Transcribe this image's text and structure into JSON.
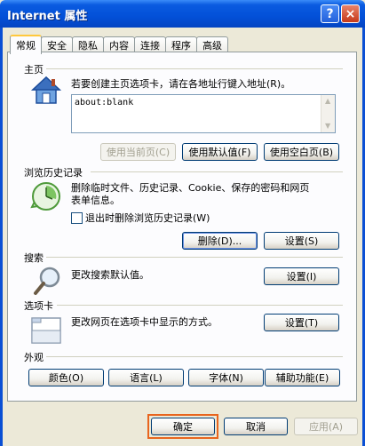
{
  "window": {
    "title": "Internet 属性",
    "help_label": "?",
    "close_label": "×"
  },
  "tabs": [
    {
      "label": "常规",
      "active": true
    },
    {
      "label": "安全",
      "active": false
    },
    {
      "label": "隐私",
      "active": false
    },
    {
      "label": "内容",
      "active": false
    },
    {
      "label": "连接",
      "active": false
    },
    {
      "label": "程序",
      "active": false
    },
    {
      "label": "高级",
      "active": false
    }
  ],
  "homepage": {
    "group_label": "主页",
    "description": "若要创建主页选项卡，请在各地址行键入地址(R)。",
    "url_value": "about:blank",
    "btn_current": "使用当前页(C)",
    "btn_default": "使用默认值(F)",
    "btn_blank": "使用空白页(B)",
    "icon": "house-icon"
  },
  "history": {
    "group_label": "浏览历史记录",
    "description_line1": "删除临时文件、历史记录、Cookie、保存的密码和网页",
    "description_line2": "表单信息。",
    "checkbox_label": "退出时删除浏览历史记录(W)",
    "checkbox_checked": false,
    "btn_delete": "删除(D)...",
    "btn_settings": "设置(S)",
    "icon": "history-clock-icon"
  },
  "search": {
    "group_label": "搜索",
    "description": "更改搜索默认值。",
    "btn_settings": "设置(I)",
    "icon": "magnifier-icon"
  },
  "tabs_group": {
    "group_label": "选项卡",
    "description": "更改网页在选项卡中显示的方式。",
    "btn_settings": "设置(T)",
    "icon": "tabs-window-icon"
  },
  "appearance": {
    "group_label": "外观",
    "btn_colors": "颜色(O)",
    "btn_languages": "语言(L)",
    "btn_fonts": "字体(N)",
    "btn_accessibility": "辅助功能(E)"
  },
  "footer": {
    "ok_label": "确定",
    "cancel_label": "取消",
    "apply_label": "应用(A)",
    "apply_enabled": false
  },
  "colors": {
    "titlebar": "#0350D8",
    "dialog_bg": "#ECE9D8",
    "panel_bg": "#FCFCFE",
    "highlight": "#E8651E"
  }
}
